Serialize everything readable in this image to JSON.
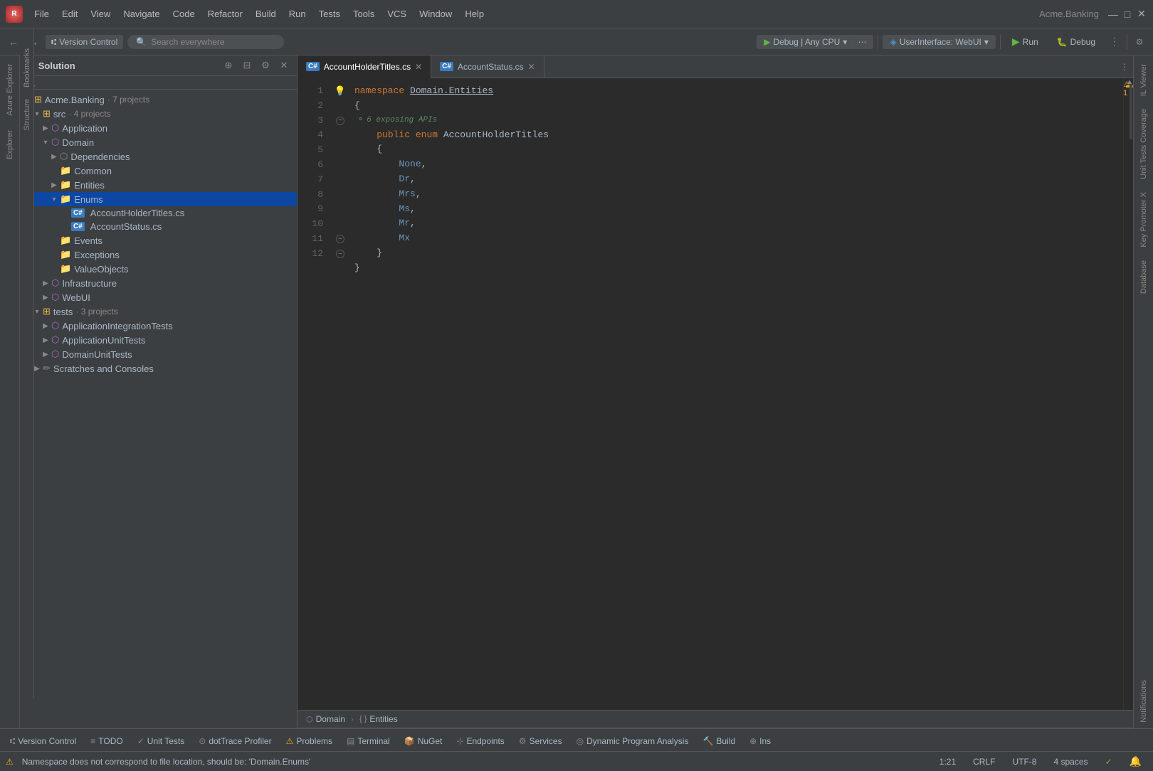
{
  "titlebar": {
    "logo": "R",
    "menu": [
      "File",
      "Edit",
      "View",
      "Navigate",
      "Code",
      "Refactor",
      "Build",
      "Run",
      "Tests",
      "Tools",
      "VCS",
      "Window",
      "Help"
    ],
    "app_title": "Acme.Banking",
    "window_controls": [
      "—",
      "□",
      "✕"
    ]
  },
  "toolbar": {
    "nav_back": "←",
    "nav_fwd": "→",
    "vc_label": "Version Control",
    "search_placeholder": "Search everywhere",
    "run_config": "Debug | Any CPU",
    "run_ui": "UserInterface: WebUI",
    "run_label": "Run",
    "debug_label": "Debug"
  },
  "file_tree": {
    "title": "Solution",
    "root": {
      "name": "Acme.Banking",
      "extra": "· 7 projects",
      "children": [
        {
          "name": "src",
          "extra": "· 4 projects",
          "expanded": true,
          "children": [
            {
              "name": "Application",
              "type": "project"
            },
            {
              "name": "Domain",
              "type": "project",
              "expanded": true,
              "children": [
                {
                  "name": "Dependencies",
                  "type": "folder",
                  "expandable": true
                },
                {
                  "name": "Common",
                  "type": "folder"
                },
                {
                  "name": "Entities",
                  "type": "folder",
                  "expandable": true
                },
                {
                  "name": "Enums",
                  "type": "folder",
                  "expanded": true,
                  "selected": true,
                  "children": [
                    {
                      "name": "AccountHolderTitles.cs",
                      "type": "cs"
                    },
                    {
                      "name": "AccountStatus.cs",
                      "type": "cs"
                    }
                  ]
                },
                {
                  "name": "Events",
                  "type": "folder"
                },
                {
                  "name": "Exceptions",
                  "type": "folder"
                },
                {
                  "name": "ValueObjects",
                  "type": "folder"
                }
              ]
            },
            {
              "name": "Infrastructure",
              "type": "project",
              "expandable": true
            },
            {
              "name": "WebUI",
              "type": "project",
              "expandable": true
            }
          ]
        },
        {
          "name": "tests",
          "extra": "· 3 projects",
          "expanded": true,
          "children": [
            {
              "name": "ApplicationIntegrationTests",
              "type": "project",
              "expandable": true
            },
            {
              "name": "ApplicationUnitTests",
              "type": "project",
              "expandable": true
            },
            {
              "name": "DomainUnitTests",
              "type": "project",
              "expandable": true
            }
          ]
        },
        {
          "name": "Scratches and Consoles",
          "type": "scratches"
        }
      ]
    }
  },
  "editor": {
    "tabs": [
      {
        "name": "AccountHolderTitles.cs",
        "active": true
      },
      {
        "name": "AccountStatus.cs",
        "active": false
      }
    ],
    "breadcrumb": [
      "Domain",
      "Entities"
    ],
    "lines": [
      {
        "num": 1,
        "content": "namespace Domain.Entities",
        "type": "namespace"
      },
      {
        "num": 2,
        "content": "{",
        "type": "brace"
      },
      {
        "num": 3,
        "content": "    public enum AccountHolderTitles",
        "type": "enum-decl"
      },
      {
        "num": 4,
        "content": "    {",
        "type": "brace"
      },
      {
        "num": 5,
        "content": "        None,",
        "type": "value"
      },
      {
        "num": 6,
        "content": "        Dr,",
        "type": "value"
      },
      {
        "num": 7,
        "content": "        Mrs,",
        "type": "value"
      },
      {
        "num": 8,
        "content": "        Ms,",
        "type": "value"
      },
      {
        "num": 9,
        "content": "        Mr,",
        "type": "value"
      },
      {
        "num": 10,
        "content": "        Mx",
        "type": "value"
      },
      {
        "num": 11,
        "content": "    }",
        "type": "brace"
      },
      {
        "num": 12,
        "content": "}",
        "type": "brace"
      }
    ],
    "hint": "6 exposing APIs",
    "warning": "1"
  },
  "right_panel": {
    "tabs": [
      "IL Viewer",
      "Unit Tests Coverage",
      "Key Promoter X",
      "Database",
      "Notifications"
    ]
  },
  "bottom_tools": {
    "items": [
      {
        "icon": "⑆",
        "label": "Version Control"
      },
      {
        "icon": "≡",
        "label": "TODO"
      },
      {
        "icon": "✓",
        "label": "Unit Tests"
      },
      {
        "icon": "⊙",
        "label": "dotTrace Profiler"
      },
      {
        "icon": "⚠",
        "label": "Problems"
      },
      {
        "icon": "▤",
        "label": "Terminal"
      },
      {
        "icon": "📦",
        "label": "NuGet"
      },
      {
        "icon": "⊹",
        "label": "Endpoints"
      },
      {
        "icon": "⚙",
        "label": "Services"
      },
      {
        "icon": "◎",
        "label": "Dynamic Program Analysis"
      },
      {
        "icon": "🔨",
        "label": "Build"
      },
      {
        "icon": "⊕",
        "label": "Ins"
      }
    ]
  },
  "status_bar": {
    "warning_text": "Namespace does not correspond to file location, should be: 'Domain.Enums'",
    "position": "1:21",
    "line_ending": "CRLF",
    "encoding": "UTF-8",
    "indent": "4 spaces",
    "git_branch": "✓",
    "notification_icon": "🔔"
  },
  "bookmarks_sidebar": {
    "items": [
      "Bookmarks",
      "Structure"
    ]
  },
  "azure_sidebar": {
    "items": [
      "Azure Explorer",
      "Explorer"
    ]
  }
}
